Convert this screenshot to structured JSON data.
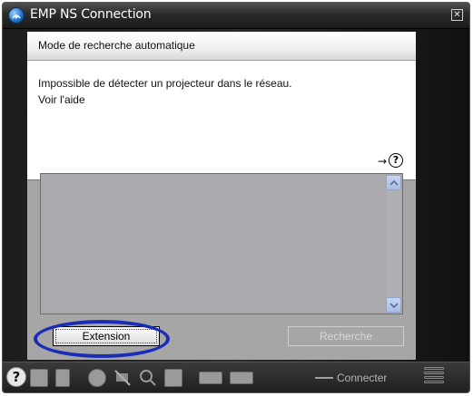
{
  "window": {
    "title": "EMP NS Connection",
    "close_label": "☒"
  },
  "mode_bar": {
    "label": "Mode de recherche automatique"
  },
  "message": {
    "line1": "Impossible de détecter un projecteur dans le réseau.",
    "line2": "Voir l'aide",
    "help_arrow": "→",
    "help_glyph": "?"
  },
  "buttons": {
    "extension": "Extension",
    "recherche": "Recherche"
  },
  "toolbar": {
    "help_glyph": "?",
    "connect_label": "Connecter",
    "icons": [
      "help-icon",
      "projector-icon",
      "document-icon",
      "pause-icon",
      "no-display-icon",
      "zoom-icon",
      "source-icon",
      "ethernet-icon",
      "keyboard-icon",
      "connect-plug-icon"
    ]
  },
  "colors": {
    "highlight_ring": "#1a2db8",
    "panel_bg": "#a6a6a6",
    "titlebar": "#2a2a2a"
  }
}
